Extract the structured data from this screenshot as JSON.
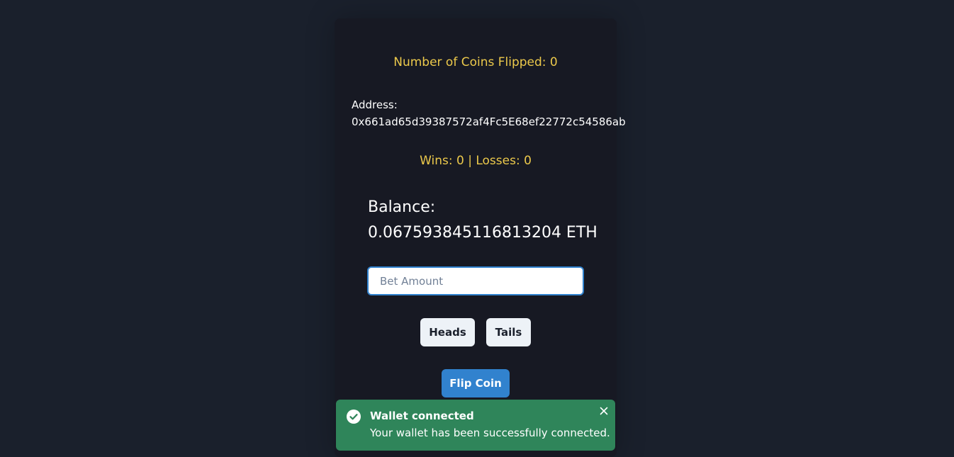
{
  "stats": {
    "coins_flipped": "Number of Coins Flipped: 0",
    "wins_losses": "Wins: 0 | Losses: 0"
  },
  "account": {
    "address_label": "Address:",
    "address_value": "0x661ad65d39387572af4Fc5E68ef22772c54586ab",
    "balance_label": "Balance:",
    "balance_value": "0.067593845116813204 ETH"
  },
  "bet": {
    "placeholder": "Bet Amount",
    "value": ""
  },
  "buttons": {
    "heads": "Heads",
    "tails": "Tails",
    "flip": "Flip Coin"
  },
  "toast": {
    "title": "Wallet connected",
    "description": "Your wallet has been successfully connected.",
    "icon": "check-circle-icon",
    "close_icon": "close-icon"
  },
  "colors": {
    "page_bg": "#1a202c",
    "card_bg": "#171923",
    "accent_yellow": "#ecc94b",
    "primary_blue": "#3182ce",
    "toast_green": "#2f855a"
  }
}
